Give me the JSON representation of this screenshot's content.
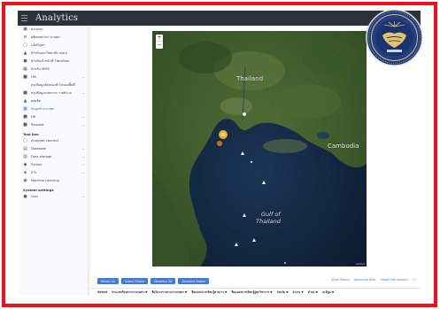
{
  "app": {
    "brand": "Analytics"
  },
  "sidebar": {
    "items": [
      {
        "icon": "truck-icon",
        "label": "ตลาดบน",
        "sub": false,
        "chevron": false,
        "active": false
      },
      {
        "icon": "list-icon",
        "label": "ผลิตผลทางการเกษตร",
        "sub": false,
        "chevron": false,
        "active": false
      },
      {
        "icon": "file-icon",
        "label": "แจ้งปัญหา",
        "sub": false,
        "chevron": false,
        "active": false
      },
      {
        "icon": "chart-icon",
        "label": "สำหรับมหาวิทยาลัย mark",
        "sub": false,
        "chevron": false,
        "active": false
      },
      {
        "icon": "user-icon",
        "label": "สำหรับเจ้าหน้าที่ Tfertiliser",
        "sub": false,
        "chevron": false,
        "active": false
      },
      {
        "icon": "building-icon",
        "label": "สำหรับ WMS",
        "sub": false,
        "chevron": false,
        "active": false
      },
      {
        "icon": "folder-icon",
        "label": "HM",
        "sub": false,
        "chevron": true,
        "active": false
      },
      {
        "icon": "",
        "label": "สรุปข้อมูลลักษณะทั่วไปของพื้นที่",
        "sub": true,
        "chevron": false,
        "active": false
      },
      {
        "icon": "folder-icon",
        "label": "สรุปข้อมูลเกษตรกร รายตำบล",
        "sub": false,
        "chevron": true,
        "active": false
      },
      {
        "icon": "chart-icon",
        "label": "ผลผลิต",
        "sub": false,
        "chevron": false,
        "active": false
      },
      {
        "icon": "grid-icon",
        "label": "ข้อมูลทั่วประเทศ",
        "sub": false,
        "chevron": false,
        "active": true
      },
      {
        "icon": "folder-icon",
        "label": "HR",
        "sub": false,
        "chevron": true,
        "active": false
      },
      {
        "icon": "folder-icon",
        "label": "Request",
        "sub": false,
        "chevron": true,
        "active": false
      }
    ],
    "section_tools": "Tool box",
    "tool_items": [
      {
        "icon": "file-icon",
        "label": "Analyzer connect",
        "chevron": false
      },
      {
        "icon": "database-icon",
        "label": "Database",
        "chevron": true
      },
      {
        "icon": "storage-icon",
        "label": "Data storage",
        "chevron": true
      },
      {
        "icon": "code-icon",
        "label": "Python",
        "chevron": true
      },
      {
        "icon": "etl-icon",
        "label": "ETL",
        "chevron": true
      },
      {
        "icon": "ml-icon",
        "label": "Machine Learning",
        "chevron": false
      }
    ],
    "section_settings": "System settings",
    "settings_items": [
      {
        "icon": "user-icon",
        "label": "User",
        "chevron": true
      }
    ]
  },
  "map": {
    "labels": {
      "thailand": "Thailand",
      "cambodia": "Cambodia",
      "gulf_line1": "Gulf of",
      "gulf_line2": "Thailand"
    },
    "zoom_in": "+",
    "zoom_out": "−",
    "attribution": "Leaflet"
  },
  "toolbar": {
    "buttons": [
      "Select All",
      "Select Visible",
      "Deselect All",
      "Deselect Visible"
    ],
    "tools": [
      "Show Search",
      "Advanced Filter",
      "Show/Hide columns"
    ],
    "more": "⋯"
  },
  "table": {
    "columns": [
      "Select",
      "ประเภทเรื่องทางการเกษตร",
      "ชื่อโครงการทางการเกษตร",
      "ชื่อแหล่งการเรียนรู้ทางการ",
      "ชื่อแหล่งการเรียนรู้สู่ทุกวิชาการ",
      "จังหวัด",
      "อำเภอ",
      "ตำบล",
      "ละติจูด"
    ]
  },
  "colors": {
    "frame": "#f00f1a",
    "accent": "#3d7be0",
    "topbar": "#2c323a",
    "map_water": "#12233a"
  }
}
